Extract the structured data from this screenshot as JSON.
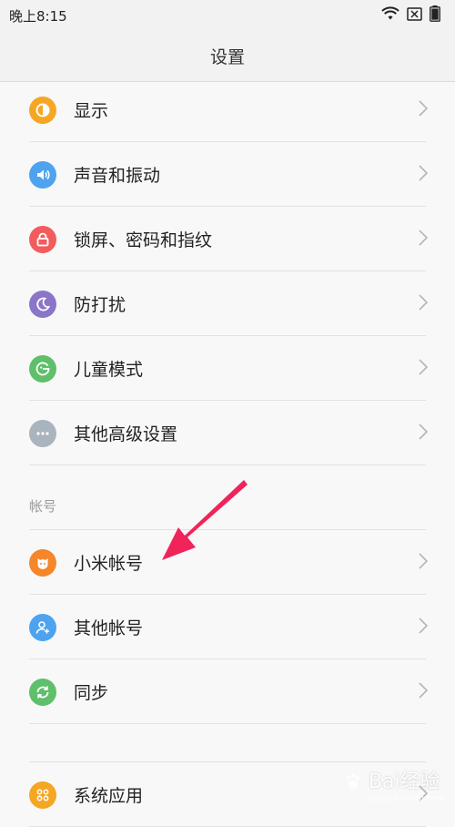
{
  "status_bar": {
    "time": "晚上8:15",
    "icons": [
      "wifi-icon",
      "no-sim-icon",
      "battery-icon"
    ]
  },
  "header": {
    "title": "设置"
  },
  "items_top": [
    {
      "label": "显示",
      "icon": "display-icon",
      "color": "#f5a623"
    },
    {
      "label": "声音和振动",
      "icon": "speaker-icon",
      "color": "#4da3ef"
    },
    {
      "label": "锁屏、密码和指纹",
      "icon": "lock-icon",
      "color": "#f25c5c"
    },
    {
      "label": "防打扰",
      "icon": "moon-icon",
      "color": "#8b75c9"
    },
    {
      "label": "儿童模式",
      "icon": "child-mode-icon",
      "color": "#5fbf6a"
    },
    {
      "label": "其他高级设置",
      "icon": "more-dots-icon",
      "color": "#a9b4bf"
    }
  ],
  "section_accounts": {
    "label": "帐号"
  },
  "items_accounts": [
    {
      "label": "小米帐号",
      "icon": "mi-account-icon",
      "color": "#f5862a"
    },
    {
      "label": "其他帐号",
      "icon": "user-add-icon",
      "color": "#4da3ef"
    },
    {
      "label": "同步",
      "icon": "sync-icon",
      "color": "#5fbf6a"
    }
  ],
  "items_apps": [
    {
      "label": "系统应用",
      "icon": "apps-grid-icon",
      "color": "#f5a623"
    }
  ],
  "annotation": {
    "arrow_color": "#f0245a"
  },
  "watermark": {
    "text": "Bai经验",
    "sub": "jingyan.baidu.com"
  }
}
